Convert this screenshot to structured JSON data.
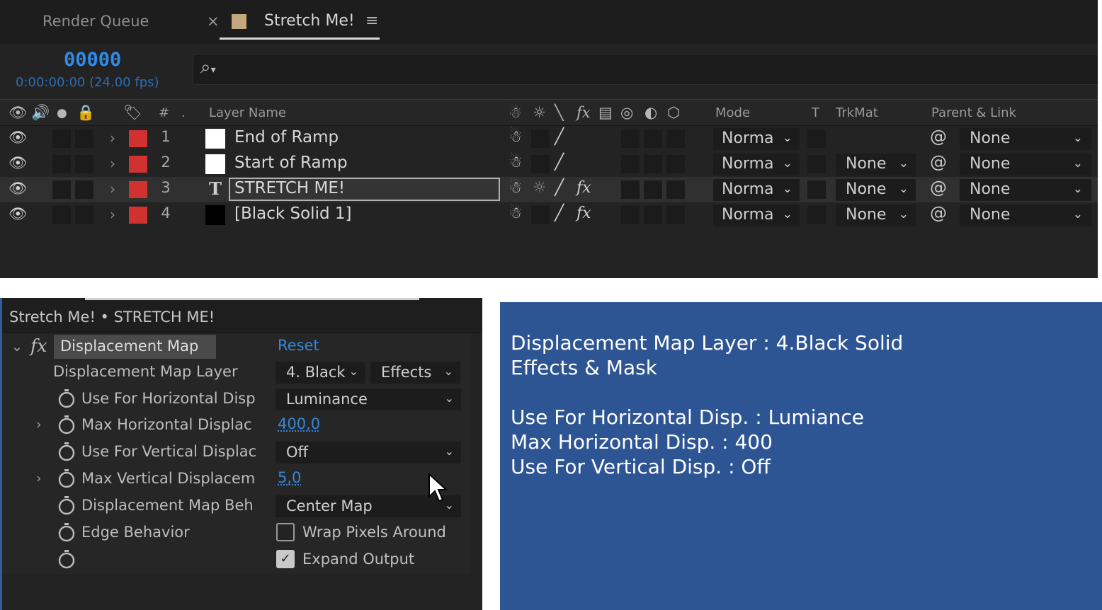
{
  "timeline": {
    "tabs": [
      {
        "label": "Render Queue"
      },
      {
        "label": "Stretch Me!",
        "close_glyph": "×",
        "menu_glyph": "≡",
        "swatch_color": "#c4a77c"
      }
    ],
    "timecode_frame": "00000",
    "timecode_time": "0:00:00:00 (24.00 fps)",
    "search_placeholder": "",
    "columns": {
      "hash": "#",
      "dot": ".",
      "layer_name": "Layer Name",
      "mode": "Mode",
      "t": "T",
      "trkmat": "TrkMat",
      "parent": "Parent & Link"
    },
    "layers": [
      {
        "num": "1",
        "name": "End of Ramp",
        "swatch": "#ffffff",
        "type": "solid",
        "fx": false,
        "mode": "Norma",
        "trkmat": "",
        "parent": "None",
        "selected": false
      },
      {
        "num": "2",
        "name": "Start of Ramp",
        "swatch": "#ffffff",
        "type": "solid",
        "fx": false,
        "mode": "Norma",
        "trkmat": "None",
        "parent": "None",
        "selected": false
      },
      {
        "num": "3",
        "name": "STRETCH ME!",
        "swatch": "",
        "type": "text",
        "fx": true,
        "mode": "Norma",
        "trkmat": "None",
        "parent": "None",
        "selected": true
      },
      {
        "num": "4",
        "name": "[Black Solid 1]",
        "swatch": "#000000",
        "type": "solid",
        "fx": true,
        "mode": "Norma",
        "trkmat": "None",
        "parent": "None",
        "selected": false
      }
    ],
    "colors": {
      "label_red": "#d03232",
      "timecode_blue": "#2d8ceb"
    }
  },
  "effect_controls": {
    "title": "Stretch Me! • STRETCH ME!",
    "effect_name": "Displacement Map",
    "reset_label": "Reset",
    "properties": {
      "map_layer": {
        "label": "Displacement Map Layer",
        "value": "4. Black",
        "source": "Effects"
      },
      "use_horizontal": {
        "label": "Use For Horizontal Disp",
        "value": "Luminance"
      },
      "max_horizontal": {
        "label": "Max Horizontal Displac",
        "value": "400,0"
      },
      "use_vertical": {
        "label": "Use For Vertical Displac",
        "value": "Off"
      },
      "max_vertical": {
        "label": "Max Vertical Displacem",
        "value": "5,0"
      },
      "map_behavior": {
        "label": "Displacement Map Beh",
        "value": "Center Map"
      },
      "edge_behavior": {
        "label": "Edge Behavior",
        "wrap_label": "Wrap Pixels Around",
        "wrap_checked": false
      },
      "expand_output": {
        "label": "Expand Output",
        "checked": true
      }
    },
    "colors": {
      "value_blue": "#3586d8"
    }
  },
  "note": {
    "lines": [
      "Displacement Map Layer : 4.Black Solid",
      "Effects & Mask",
      "",
      "Use For Horizontal Disp. : Lumiance",
      "Max Horizontal Disp. : 400",
      "Use For Vertical Disp. : Off"
    ],
    "background": "#2e5593"
  }
}
